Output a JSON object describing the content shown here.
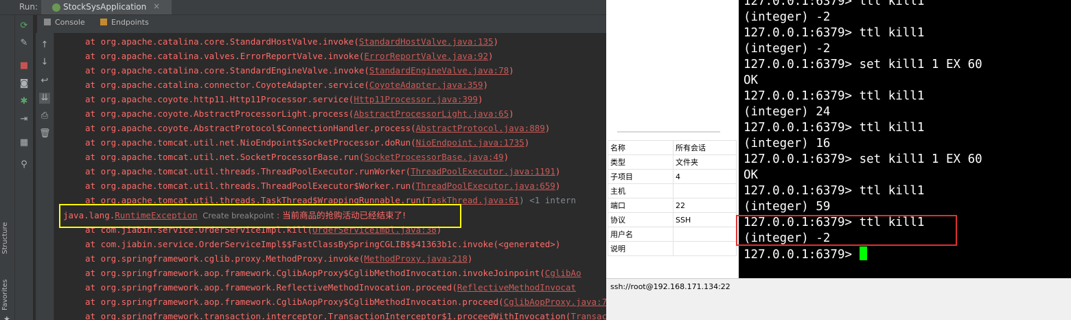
{
  "run": {
    "label": "Run:",
    "tab_title": "StockSysApplication",
    "close": "×"
  },
  "subtabs": [
    {
      "label": "Console"
    },
    {
      "label": "Endpoints"
    }
  ],
  "side_tabs": {
    "structure": "Structure",
    "favorites": "Favorites",
    "star": "★"
  },
  "tool_icons": [
    "rerun-icon",
    "wrench-icon",
    "stop-icon",
    "camera-icon",
    "debug-icon",
    "exit-icon",
    "layout-icon",
    "pin-icon"
  ],
  "console": {
    "lines": [
      {
        "pre": "at org.apache.catalina.core.StandardHostValve.invoke(",
        "link": "StandardHostValve.java:135",
        "post": ")"
      },
      {
        "pre": "at org.apache.catalina.valves.ErrorReportValve.invoke(",
        "link": "ErrorReportValve.java:92",
        "post": ")"
      },
      {
        "pre": "at org.apache.catalina.core.StandardEngineValve.invoke(",
        "link": "StandardEngineValve.java:78",
        "post": ")"
      },
      {
        "pre": "at org.apache.catalina.connector.CoyoteAdapter.service(",
        "link": "CoyoteAdapter.java:359",
        "post": ")"
      },
      {
        "pre": "at org.apache.coyote.http11.Http11Processor.service(",
        "link": "Http11Processor.java:399",
        "post": ")"
      },
      {
        "pre": "at org.apache.coyote.AbstractProcessorLight.process(",
        "link": "AbstractProcessorLight.java:65",
        "post": ")"
      },
      {
        "pre": "at org.apache.coyote.AbstractProtocol$ConnectionHandler.process(",
        "link": "AbstractProtocol.java:889",
        "post": ")"
      },
      {
        "pre": "at org.apache.tomcat.util.net.NioEndpoint$SocketProcessor.doRun(",
        "link": "NioEndpoint.java:1735",
        "post": ")"
      },
      {
        "pre": "at org.apache.tomcat.util.net.SocketProcessorBase.run(",
        "link": "SocketProcessorBase.java:49",
        "post": ")"
      },
      {
        "pre": "at org.apache.tomcat.util.threads.ThreadPoolExecutor.runWorker(",
        "link": "ThreadPoolExecutor.java:1191",
        "post": ")"
      },
      {
        "pre": "at org.apache.tomcat.util.threads.ThreadPoolExecutor$Worker.run(",
        "link": "ThreadPoolExecutor.java:659",
        "post": ")"
      },
      {
        "pre": "at org.apache.tomcat.util.threads.TaskThread$WrappingRunnable.run(",
        "link": "TaskThread.java:61",
        "post": ") <1 intern"
      }
    ],
    "exception": {
      "prefix": "java.lang.",
      "name": "RuntimeException",
      "breakpoint": "Create breakpoint",
      "message": " : 当前商品的抢购活动已经结束了!"
    },
    "lines2": [
      {
        "pre": "at com.jiabin.service.OrderServiceImpl.kill(",
        "link": "OrderServiceImpl.java:38",
        "post": ")"
      },
      {
        "pre": "at com.jiabin.service.OrderServiceImpl$$FastClassBySpringCGLIB$$41363b1c.invoke(<generated>)",
        "link": "",
        "post": ""
      },
      {
        "pre": "at org.springframework.cglib.proxy.MethodProxy.invoke(",
        "link": "MethodProxy.java:218",
        "post": ")"
      },
      {
        "pre": "at org.springframework.aop.framework.CglibAopProxy$CglibMethodInvocation.invokeJoinpoint(",
        "link": "CglibAo",
        "post": ""
      },
      {
        "pre": "at org.springframework.aop.framework.ReflectiveMethodInvocation.proceed(",
        "link": "ReflectiveMethodInvocat",
        "post": ""
      },
      {
        "pre": "at org.springframework.aop.framework.CglibAopProxy$CglibMethodInvocation.proceed(",
        "link": "CglibAopProxy.java:753",
        "post": ")"
      },
      {
        "pre": "at org.springframework.transaction.interceptor.TransactionInterceptor$1.proceedWithInvocation(",
        "link": "TransactionInterceptor.java:123",
        "post": ")"
      }
    ]
  },
  "properties": [
    {
      "key": "名称",
      "value": "所有会话"
    },
    {
      "key": "类型",
      "value": "文件夹"
    },
    {
      "key": "子项目",
      "value": "4"
    },
    {
      "key": "主机",
      "value": ""
    },
    {
      "key": "端口",
      "value": "22"
    },
    {
      "key": "协议",
      "value": "SSH"
    },
    {
      "key": "用户名",
      "value": ""
    },
    {
      "key": "说明",
      "value": ""
    }
  ],
  "terminal": {
    "lines": [
      "127.0.0.1:6379> ttl kill1",
      "(integer) -2",
      "127.0.0.1:6379> ttl kill1",
      "(integer) -2",
      "127.0.0.1:6379> set kill1 1 EX 60",
      "OK",
      "127.0.0.1:6379> ttl kill1",
      "(integer) 24",
      "127.0.0.1:6379> ttl kill1",
      "(integer) 16",
      "127.0.0.1:6379> set kill1 1 EX 60",
      "OK",
      "127.0.0.1:6379> ttl kill1",
      "(integer) 59",
      "127.0.0.1:6379> ttl kill1",
      "(integer) -2",
      "127.0.0.1:6379> "
    ]
  },
  "status": {
    "session": "ssh://root@192.168.171.134:22"
  },
  "colors": {
    "highlight_yellow": "#ffff00",
    "highlight_red": "#e03030",
    "cursor": "#00ff00",
    "error_text": "#ff6b68"
  }
}
